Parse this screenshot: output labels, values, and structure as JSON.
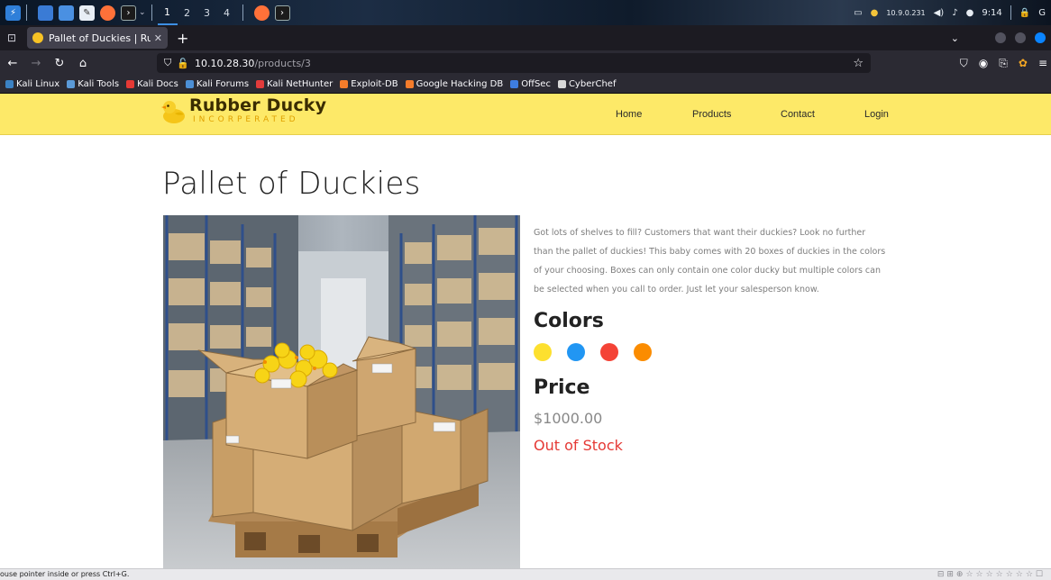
{
  "kali_panel": {
    "workspaces": [
      "1",
      "2",
      "3",
      "4"
    ],
    "ip": "10.9.0.231",
    "time": "9:14",
    "g_label": "G"
  },
  "browser": {
    "tab_title": "Pallet of Duckies | Rubber",
    "url_host": "10.10.28.30",
    "url_path": "/products/3",
    "bookmarks": [
      "Kali Linux",
      "Kali Tools",
      "Kali Docs",
      "Kali Forums",
      "Kali NetHunter",
      "Exploit-DB",
      "Google Hacking DB",
      "OffSec",
      "CyberChef"
    ]
  },
  "site": {
    "brand_name": "Rubber Ducky",
    "brand_sub": "INCORPERATED",
    "nav": [
      "Home",
      "Products",
      "Contact",
      "Login"
    ]
  },
  "product": {
    "title": "Pallet of Duckies",
    "description": "Got lots of shelves to fill? Customers that want their duckies? Look no further than the pallet of duckies! This baby comes with 20 boxes of duckies in the colors of your choosing. Boxes can only contain one color ducky but multiple colors can be selected when you call to order. Just let your salesperson know.",
    "colors_heading": "Colors",
    "colors": [
      "#fde02f",
      "#2196f3",
      "#f44336",
      "#fb8c00"
    ],
    "price_heading": "Price",
    "price": "$1000.00",
    "stock_status": "Out of Stock"
  },
  "statusbar": {
    "text": "ouse pointer inside or press Ctrl+G."
  }
}
